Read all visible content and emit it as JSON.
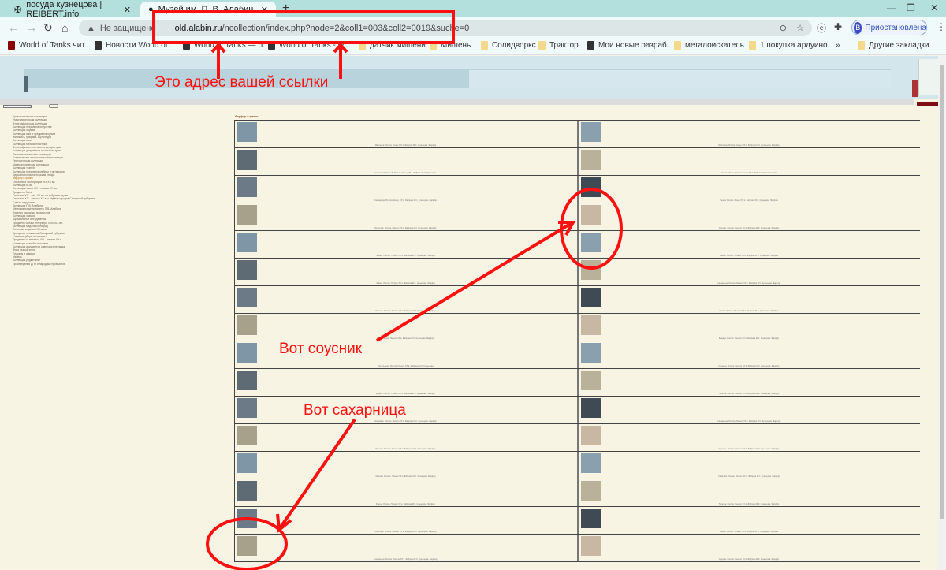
{
  "browser": {
    "tabs": [
      {
        "title": "посуда кузнецова | REIBERT.info",
        "icon": "cross-icon"
      },
      {
        "title": "Музей им. П. В. Алабина / Муз",
        "icon": "globe-icon"
      }
    ],
    "security_label": "Не защищено",
    "url_host": "old.alabin.ru",
    "url_path": "/ncollection/index.php?node=2&coll1=003&coll2=0019&suche=0",
    "profile_initial": "B",
    "profile_label": "Приостановлена",
    "bookmarks": [
      "World of Tanks чит...",
      "Новости World of...",
      "World of Tanks — б...",
      "World of Tanks - Ф...",
      "датчик мишени",
      "Мишень",
      "Солидворкс",
      "Трактор",
      "Мои новые разраб...",
      "металоискатель",
      "1 покупка  ардуино"
    ],
    "other_bookmarks": "Другие закладки"
  },
  "site": {
    "section_title": "Фарфор и фаянс",
    "sidebar": [
      "Археологическая коллекция",
      "Нумизматическая коллекция",
      "Этнографическая коллекция",
      "Коллекция предметов искусства",
      "Коллекция оружия",
      "Коллекция книг и предметов культа",
      "Живопись, графика, скульптура",
      "Коллекция икон",
      "Коллекция мелкой пластики",
      "Фотографии и негативы по истории края",
      "Коллекция документов по истории края",
      "Палеонтологическая коллекция",
      "Ботанические и зоологические коллекции",
      "Геологическая коллекция",
      "Минералогическая коллекция",
      "Коллекция тканей",
      "Коллекция предметов мебели и интерьера",
      "Церковная и монастырская утварь",
      "Фарфор и фаянс",
      "Открытки и фотографии XIX-XX вв.",
      "Коллекция ВОВ",
      "Коллекция часов XIX - начала XX вв.",
      "Предметы быта",
      "Открытки XIX - нач. XX вв. из собрания музея",
      "Открытки XIX - начала XX в. с видами городов Самарской губернии",
      "Стекло и хрусталь",
      "Коллекция П.В. Алабина",
      "Мемориальные предметы П.В. Алабина",
      "Изделия народных промыслов",
      "Коллекция значков",
      "Музыкальные инструменты",
      "Предметы быта и интерьера XVIII-XIX вв.",
      "Коллекция медалей и наград",
      "Печатные издания XIX века",
      "Кустарные промыслы Самарской губернии",
      "Головные уборы и костюмы",
      "Предметы из металла XIX - начала XX в.",
      "Коллекция тканей и вышивки",
      "Коллекция документов советского периода",
      "Фонд редкой книги",
      "Плакаты и афиши",
      "Мебель",
      "Коллекция редких книг",
      "Произведения ДПИ и народных промыслов"
    ],
    "items": [
      [
        "Масленка. Россия. Конец XIX в. Фабрика М.С. Кузнецова. Фарфор.",
        "Молочник. Россия. Конец XIX в. Фабрика М.С. Кузнецова. Фарфор."
      ],
      [
        "Чайник заварочный. Россия. Конец XIX в. Фабрика М.С. Кузнецова.",
        "Чашка чайная. Россия. Конец XIX в. Фабрика М.С. Кузнецова."
      ],
      [
        "Сахарница. Россия. Конец XIX в. Фабрика М.С. Кузнецова. Фарфор.",
        "Чашка. Россия. Конец XIX в. Фабрика М.С. Кузнецова. Фарфор."
      ],
      [
        "Молочник. Россия. Начало XX в. Фабрика М.С. Кузнецова. Фарфор.",
        "Соусник. Россия. Начало XX в. Фабрика М.С. Кузнецова. Фарфор."
      ],
      [
        "Чайник. Россия. Начало XX в. Фабрика М.С. Кузнецова. Фарфор.",
        "Чашка. Россия. Начало XX в. Фабрика М.С. Кузнецова. Фарфор."
      ],
      [
        "Чайник. Россия. Начало XX в. Фабрика М.С. Кузнецова. Фарфор.",
        "Сахарница. Россия. Начало XX в. Фабрика М.С. Кузнецова. Фарфор."
      ],
      [
        "Тарелка. Россия. Начало XX в. Фабрика М.С. Кузнецова. Фарфор.",
        "Чашка. Россия. Начало XX в. Фабрика М.С. Кузнецова. Фарфор."
      ],
      [
        "Ваза. Россия. Начало XX в. Фабрика М.С. Кузнецова. Фарфор.",
        "Блюдце. Россия. Начало XX в. Фабрика М.С. Кузнецова. Фарфор."
      ],
      [
        "Пепельница. Россия. Начало XX в. Фабрика М.С. Кузнецова.",
        "Супница. Россия. Начало XX в. Фабрика М.С. Кузнецова. Фарфор."
      ],
      [
        "Кружка. Россия. Начало XX в. Фабрика М.С. Кузнецова. Фарфор.",
        "Тарелка. Россия. Начало XX в. Фабрика М.С. Кузнецова. Фарфор."
      ],
      [
        "Кофейник. Россия. Начало XX в. Фабрика М.С. Кузнецова. Фарфор.",
        "Сахарница. Россия. Начало XX в. Фабрика М.С. Кузнецова. Фарфор."
      ],
      [
        "Тарелка. Россия. Начало XX в. Фабрика М.С. Кузнецова. Фарфор.",
        "Супница. Россия. Начало XX в. Фабрика М.С. Кузнецова. Фарфор."
      ],
      [
        "Тарелка. Россия. Начало XX в. Фабрика М.С. Кузнецова. Фарфор.",
        "Салатник. Россия. Начало XX в. Фабрика М.С. Кузнецова. Фарфор."
      ],
      [
        "Блюдо. Россия. Начало XX в. Фабрика М.С. Кузнецова. Фарфор.",
        "Тарелка. Россия. Начало XX в. Фабрика М.С. Кузнецова. Фарфор."
      ],
      [
        "Салатник. Россия. Начало XX в. Фабрика М.С. Кузнецова. Фарфор.",
        "Чашка. Россия. Начало XX в. Фабрика М.С. Кузнецова. Фарфор."
      ],
      [
        "Сахарница. Россия. Начало XX в. Фабрика М.С. Кузнецова. Фарфор.",
        "Соусник. Россия. Начало XX в. Фабрика М.С. Кузнецова. Фарфор."
      ]
    ],
    "thumb_colors": [
      "#7f96a6",
      "#8aa0ae",
      "#5f6b74",
      "#b9b19a",
      "#6b7a86",
      "#3f4a55",
      "#a7a08b",
      "#c8b7a2"
    ]
  },
  "annotations": {
    "url_note": "Это адрес вашей ссылки",
    "sauce_note": "Вот соусник",
    "sugar_note": "Вот сахарница",
    "color": "#ff1010"
  }
}
